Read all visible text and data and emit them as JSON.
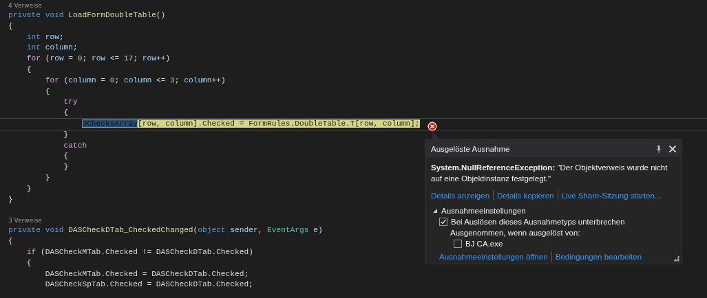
{
  "editor": {
    "blocks": [
      {
        "references": "4 Verweise",
        "lines": [
          {
            "current": false,
            "tokens": [
              {
                "text": "private",
                "kind": "keyword"
              },
              {
                "text": " void",
                "kind": "keyword"
              },
              {
                "text": " LoadFormDoubleTable",
                "kind": "method"
              },
              {
                "text": "()",
                "kind": "plain"
              }
            ]
          },
          {
            "current": false,
            "tokens": [
              {
                "text": "{",
                "kind": "plain"
              }
            ]
          },
          {
            "current": false,
            "tokens": [
              {
                "text": "    int",
                "kind": "keyword"
              },
              {
                "text": " row",
                "kind": "variable"
              },
              {
                "text": ";",
                "kind": "plain"
              }
            ]
          },
          {
            "current": false,
            "tokens": [
              {
                "text": "    int",
                "kind": "keyword"
              },
              {
                "text": " column",
                "kind": "variable"
              },
              {
                "text": ";",
                "kind": "plain"
              }
            ]
          },
          {
            "current": false,
            "tokens": [
              {
                "text": "    for",
                "kind": "control"
              },
              {
                "text": " (",
                "kind": "plain"
              },
              {
                "text": "row",
                "kind": "variable"
              },
              {
                "text": " = ",
                "kind": "plain"
              },
              {
                "text": "0",
                "kind": "number"
              },
              {
                "text": "; ",
                "kind": "plain"
              },
              {
                "text": "row",
                "kind": "variable"
              },
              {
                "text": " <= ",
                "kind": "plain"
              },
              {
                "text": "17",
                "kind": "number"
              },
              {
                "text": "; ",
                "kind": "plain"
              },
              {
                "text": "row",
                "kind": "variable"
              },
              {
                "text": "++)",
                "kind": "plain"
              }
            ]
          },
          {
            "current": false,
            "tokens": [
              {
                "text": "    {",
                "kind": "plain"
              }
            ]
          },
          {
            "current": false,
            "tokens": [
              {
                "text": "        for",
                "kind": "control"
              },
              {
                "text": " (",
                "kind": "plain"
              },
              {
                "text": "column",
                "kind": "variable"
              },
              {
                "text": " = ",
                "kind": "plain"
              },
              {
                "text": "0",
                "kind": "number"
              },
              {
                "text": "; ",
                "kind": "plain"
              },
              {
                "text": "column",
                "kind": "variable"
              },
              {
                "text": " <= ",
                "kind": "plain"
              },
              {
                "text": "3",
                "kind": "number"
              },
              {
                "text": "; ",
                "kind": "plain"
              },
              {
                "text": "column",
                "kind": "variable"
              },
              {
                "text": "++)",
                "kind": "plain"
              }
            ]
          },
          {
            "current": false,
            "tokens": [
              {
                "text": "        {",
                "kind": "plain"
              }
            ]
          },
          {
            "current": false,
            "tokens": [
              {
                "text": "            try",
                "kind": "control"
              }
            ]
          },
          {
            "current": false,
            "tokens": [
              {
                "text": "            {",
                "kind": "plain"
              }
            ]
          },
          {
            "current": true,
            "tokens": [
              {
                "text": "                DChecksArray",
                "kind": "selected"
              },
              {
                "text": "[row, column].Checked = FormRules.DoubleTable.T[row, column];",
                "kind": "statement"
              }
            ]
          },
          {
            "current": false,
            "tokens": [
              {
                "text": "            }",
                "kind": "plain"
              }
            ]
          },
          {
            "current": false,
            "tokens": [
              {
                "text": "            catch",
                "kind": "control"
              }
            ]
          },
          {
            "current": false,
            "tokens": [
              {
                "text": "            {",
                "kind": "plain"
              }
            ]
          },
          {
            "current": false,
            "tokens": [
              {
                "text": "            }",
                "kind": "plain"
              }
            ]
          },
          {
            "current": false,
            "tokens": [
              {
                "text": "        }",
                "kind": "plain"
              }
            ]
          },
          {
            "current": false,
            "tokens": [
              {
                "text": "    }",
                "kind": "plain"
              }
            ]
          },
          {
            "current": false,
            "tokens": [
              {
                "text": "}",
                "kind": "plain"
              }
            ]
          }
        ]
      },
      {
        "references": "3 Verweise",
        "lines": [
          {
            "current": false,
            "tokens": [
              {
                "text": "private",
                "kind": "keyword"
              },
              {
                "text": " void",
                "kind": "keyword"
              },
              {
                "text": " DASCheckDTab_CheckedChanged",
                "kind": "method"
              },
              {
                "text": "(",
                "kind": "plain"
              },
              {
                "text": "object",
                "kind": "keyword"
              },
              {
                "text": " sender",
                "kind": "variable"
              },
              {
                "text": ", ",
                "kind": "plain"
              },
              {
                "text": "EventArgs",
                "kind": "type"
              },
              {
                "text": " e",
                "kind": "variable"
              },
              {
                "text": ")",
                "kind": "plain"
              }
            ]
          },
          {
            "current": false,
            "tokens": [
              {
                "text": "{",
                "kind": "plain"
              }
            ]
          },
          {
            "current": false,
            "tokens": [
              {
                "text": "    if",
                "kind": "control"
              },
              {
                "text": " (DASCheckMTab.Checked != DASCheckDTab.Checked)",
                "kind": "plain"
              }
            ]
          },
          {
            "current": false,
            "tokens": [
              {
                "text": "    {",
                "kind": "plain"
              }
            ]
          },
          {
            "current": false,
            "tokens": [
              {
                "text": "        DASCheckMTab.Checked = DASCheckDTab.Checked;",
                "kind": "plain"
              }
            ]
          },
          {
            "current": false,
            "tokens": [
              {
                "text": "        DASCheckSpTab.Checked = DASCheckDTab.Checked;",
                "kind": "plain"
              }
            ]
          }
        ]
      }
    ]
  },
  "exception_popup": {
    "title": "Ausgelöste Ausnahme",
    "message": "**System.NullReferenceException:** \"Der Objektverweis wurde nicht auf eine Objektinstanz festgelegt.\"",
    "links": [
      "Details anzeigen",
      "Details kopieren",
      "Live Share-Sitzung starten..."
    ],
    "settings": {
      "label": "Ausnahmeeinstellungen",
      "expanded": true,
      "options": [
        {
          "label": "Bei Auslösen dieses Ausnahmetyps unterbrechen",
          "checked": true
        }
      ],
      "except_label": "Ausgenommen, wenn ausgelöst von:",
      "exceptions": [
        {
          "label": "BJ CA.exe",
          "checked": false
        }
      ]
    },
    "footer_links": [
      "Ausnahmeeinstellungen öffnen",
      "Bedingungen bearbeiten"
    ]
  }
}
